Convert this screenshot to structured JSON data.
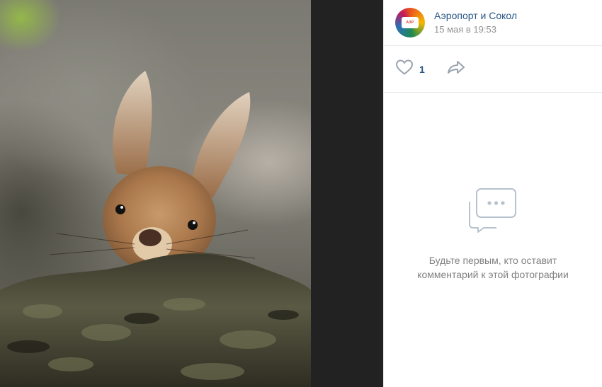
{
  "post": {
    "group_name": "Аэропорт и Сокол",
    "date": "15 мая в 19:53",
    "avatar_logo_text": "АЭРОПОРТ СОКОЛ"
  },
  "actions": {
    "like_count": "1"
  },
  "comments": {
    "empty_line1": "Будьте первым, кто оставит",
    "empty_line2": "комментарий к этой фотографии"
  },
  "icons": {
    "like": "heart-icon",
    "share": "share-arrow-icon",
    "empty": "comments-bubble-icon"
  },
  "colors": {
    "link": "#2a5885",
    "muted": "#939393",
    "icon": "#99a2ad",
    "viewer_bg": "#222222"
  }
}
